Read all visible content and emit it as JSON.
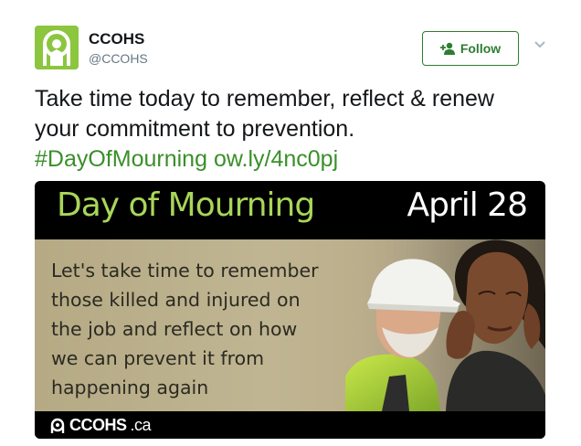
{
  "account": {
    "name": "CCOHS",
    "handle": "@CCOHS",
    "avatar_icon": "ccohs-logo-icon",
    "brand_color": "#8cc63f"
  },
  "actions": {
    "follow_label": "Follow",
    "follow_icon": "add-person-icon",
    "more_icon": "chevron-down-icon"
  },
  "tweet": {
    "line1": "Take time today to remember, reflect & renew",
    "line2": "your commitment to prevention.",
    "hashtag": "#DayOfMourning",
    "link": "ow.ly/4nc0pj",
    "link_color": "#3a8f2a"
  },
  "card": {
    "title": "Day of Mourning",
    "date": "April 28",
    "message_lines": [
      "Let's take time to remember",
      "those killed and injured on",
      "the job and reflect on how",
      "we can prevent it from",
      "happening again"
    ],
    "footer_brand": "CCOHS",
    "footer_tld": ".ca",
    "title_color": "#a8d65a"
  }
}
